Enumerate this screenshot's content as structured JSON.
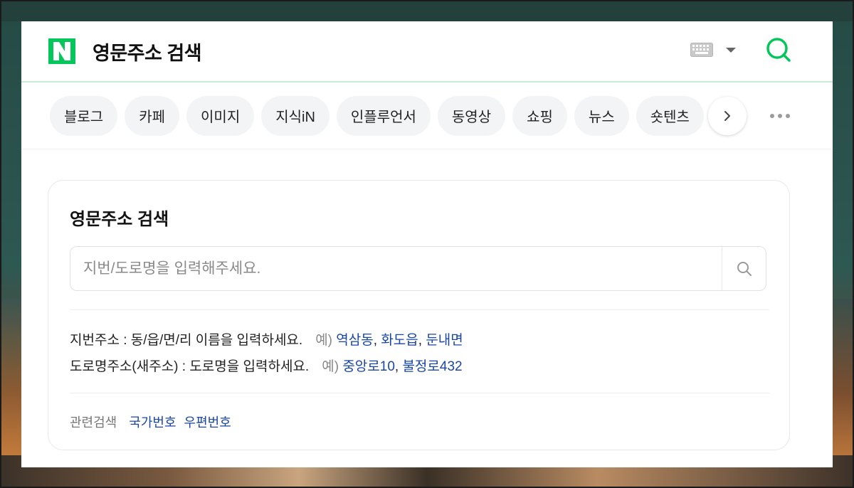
{
  "header": {
    "logo_letter": "N",
    "title": "영문주소 검색",
    "brand_color": "#03c75a"
  },
  "tabs": [
    {
      "label": "블로그"
    },
    {
      "label": "카페"
    },
    {
      "label": "이미지"
    },
    {
      "label": "지식iN"
    },
    {
      "label": "인플루언서"
    },
    {
      "label": "동영상"
    },
    {
      "label": "쇼핑"
    },
    {
      "label": "뉴스"
    },
    {
      "label": "숏텐츠"
    }
  ],
  "card": {
    "title": "영문주소 검색",
    "search_placeholder": "지번/도로명을 입력해주세요.",
    "lot_label": "지번주소 : 동/읍/면/리 이름을 입력하세요.",
    "lot_example_prefix": "예)",
    "lot_examples": [
      "역삼동",
      "화도읍",
      "둔내면"
    ],
    "road_label": "도로명주소(새주소) : 도로명을 입력하세요.",
    "road_example_prefix": "예)",
    "road_examples": [
      "중앙로10",
      "불정로432"
    ],
    "related_label": "관련검색",
    "related_links": [
      "국가번호",
      "우편번호"
    ]
  },
  "colors": {
    "link": "#1a47a3",
    "accent": "#03c75a"
  }
}
